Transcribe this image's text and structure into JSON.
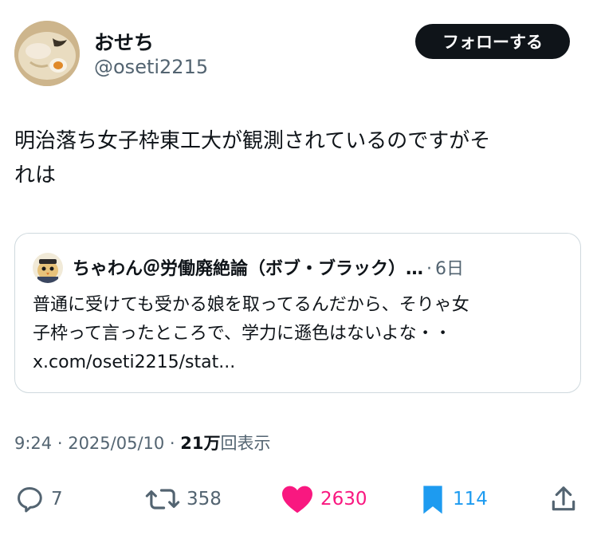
{
  "author": {
    "name": "おせち",
    "handle": "@oseti2215"
  },
  "follow_label": "フォローする",
  "tweet": {
    "text_line1": "明治落ち女子枠東工大が観測されているのですがそ",
    "text_line2": "れは"
  },
  "quote": {
    "name": "ちゃわん＠労働廃絶論（ボブ・ブラック）…",
    "dot": "·",
    "time": "6日",
    "text_line1": "普通に受けても受かる娘を取ってるんだから、そりゃ女",
    "text_line2": "子枠って言ったところで、学力に遜色はないよな・・",
    "link": "x.com/oseti2215/stat..."
  },
  "meta": {
    "time": "9:24",
    "sep1": " · ",
    "date": "2025/05/10",
    "sep2": " · ",
    "views_count": "21万",
    "views_label": "回表示"
  },
  "actions": {
    "replies": "7",
    "reposts": "358",
    "likes": "2630",
    "bookmarks": "114"
  },
  "colors": {
    "text": "#0f1419",
    "secondary": "#536471",
    "like": "#f91880",
    "bookmark": "#1d9bf0",
    "border": "#cfd9de"
  }
}
